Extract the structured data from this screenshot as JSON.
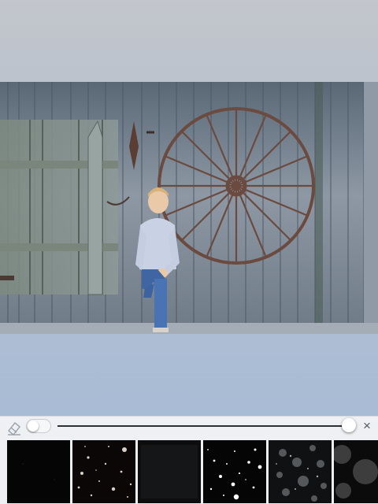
{
  "photo": {
    "description_visible": ""
  },
  "toolbar": {
    "eraser_icon": "eraser-icon",
    "toggle_on": false,
    "slider_level": 1.0,
    "close_glyph": "×"
  },
  "filters": [
    {
      "name": "overlay-1"
    },
    {
      "name": "overlay-2"
    },
    {
      "name": "overlay-3"
    },
    {
      "name": "overlay-4"
    },
    {
      "name": "overlay-5"
    },
    {
      "name": "overlay-6"
    }
  ],
  "colors": {
    "toolbar_bg": "#eef0f3",
    "track": "#2b2f36",
    "knob": "#ffffff"
  }
}
